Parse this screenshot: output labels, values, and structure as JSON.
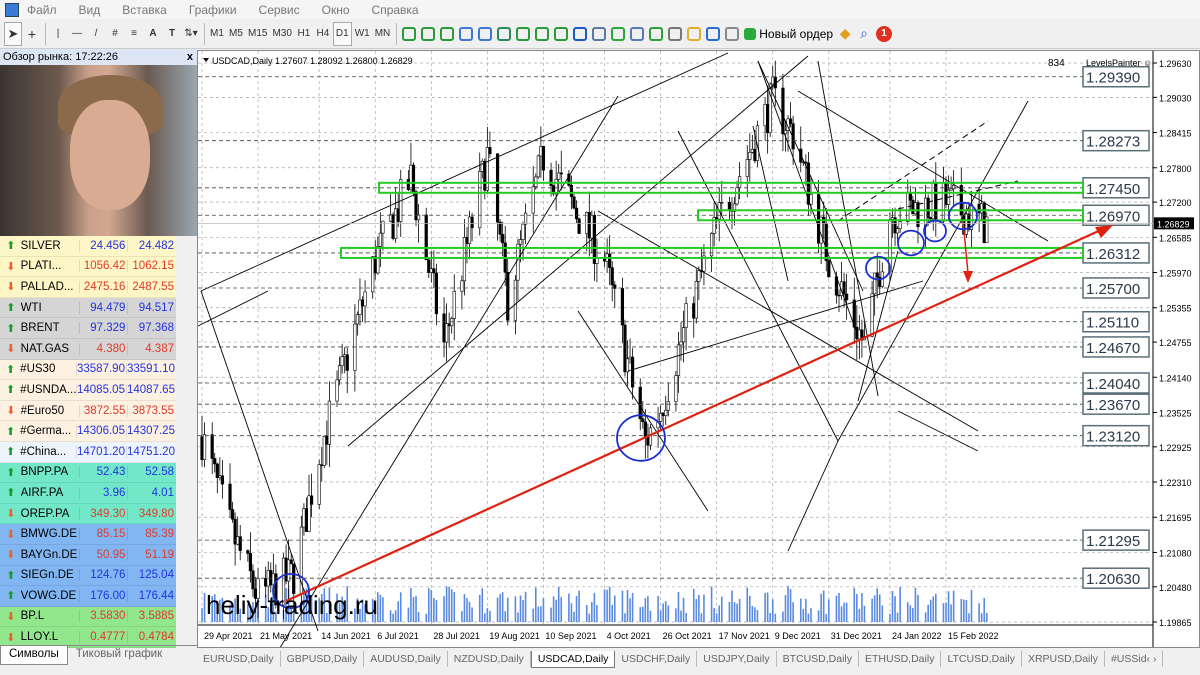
{
  "menu": [
    "Файл",
    "Вид",
    "Вставка",
    "Графики",
    "Сервис",
    "Окно",
    "Справка"
  ],
  "toolbar": {
    "timeframes": [
      "M1",
      "M5",
      "M15",
      "M30",
      "H1",
      "H4",
      "D1",
      "W1",
      "MN"
    ],
    "active_timeframe": "D1",
    "new_order": "Новый ордер",
    "notification_count": "1"
  },
  "market_watch": {
    "title": "Обзор рынка: 17:22:26",
    "close": "x",
    "rows": [
      {
        "sym": "SILVER",
        "bid": "24.456",
        "ask": "24.482",
        "dir": "up",
        "bg": "#fdf6c6"
      },
      {
        "sym": "PLATI...",
        "bid": "1056.42",
        "ask": "1062.15",
        "dir": "dn",
        "bg": "#fdf6c6"
      },
      {
        "sym": "PALLAD...",
        "bid": "2475.16",
        "ask": "2487.55",
        "dir": "dn",
        "bg": "#fdf6c6"
      },
      {
        "sym": "WTI",
        "bid": "94.479",
        "ask": "94.517",
        "dir": "up",
        "bg": "#d5d5d5"
      },
      {
        "sym": "BRENT",
        "bid": "97.329",
        "ask": "97.368",
        "dir": "up",
        "bg": "#d5d5d5"
      },
      {
        "sym": "NAT.GAS",
        "bid": "4.380",
        "ask": "4.387",
        "dir": "dn",
        "bg": "#d5d5d5"
      },
      {
        "sym": "#US30",
        "bid": "33587.90",
        "ask": "33591.10",
        "dir": "up",
        "bg": "#fdf1e2"
      },
      {
        "sym": "#USNDA...",
        "bid": "14085.05",
        "ask": "14087.65",
        "dir": "up",
        "bg": "#fdf1e2"
      },
      {
        "sym": "#Euro50",
        "bid": "3872.55",
        "ask": "3873.55",
        "dir": "dn",
        "bg": "#fdf1e2"
      },
      {
        "sym": "#Germa...",
        "bid": "14306.05",
        "ask": "14307.25",
        "dir": "up",
        "bg": "#fdf1e2"
      },
      {
        "sym": "#China...",
        "bid": "14701.20",
        "ask": "14751.20",
        "dir": "up",
        "bg": "#eef4fc"
      },
      {
        "sym": "BNPP.PA",
        "bid": "52.43",
        "ask": "52.58",
        "dir": "up",
        "bg": "#72e8c8"
      },
      {
        "sym": "AIRF.PA",
        "bid": "3.96",
        "ask": "4.01",
        "dir": "up",
        "bg": "#72e8c8"
      },
      {
        "sym": "OREP.PA",
        "bid": "349.30",
        "ask": "349.80",
        "dir": "dn",
        "bg": "#72e8c8"
      },
      {
        "sym": "BMWG.DE",
        "bid": "85.15",
        "ask": "85.39",
        "dir": "dn",
        "bg": "#82b6f2"
      },
      {
        "sym": "BAYGn.DE",
        "bid": "50.95",
        "ask": "51.19",
        "dir": "dn",
        "bg": "#82b6f2"
      },
      {
        "sym": "SIEGn.DE",
        "bid": "124.76",
        "ask": "125.04",
        "dir": "up",
        "bg": "#82b6f2"
      },
      {
        "sym": "VOWG.DE",
        "bid": "176.00",
        "ask": "176.44",
        "dir": "up",
        "bg": "#82b6f2"
      },
      {
        "sym": "BP.L",
        "bid": "3.5830",
        "ask": "3.5885",
        "dir": "dn",
        "bg": "#92e68c"
      },
      {
        "sym": "LLOY.L",
        "bid": "0.4777",
        "ask": "0.4784",
        "dir": "dn",
        "bg": "#92e68c"
      }
    ],
    "tabs": [
      "Символы",
      "Тиковый график"
    ]
  },
  "chart": {
    "header": "USDCAD,Daily  1.27607 1.28092 1.26800 1.26829",
    "bar_count": "834",
    "indicator": "LevelsPainter ☺",
    "watermark": "heliy-trading.ru",
    "current_price": "1.26829",
    "price_ticks": [
      "1.29630",
      "1.29030",
      "1.28415",
      "1.27800",
      "1.27200",
      "1.26585",
      "1.25970",
      "1.25355",
      "1.24755",
      "1.24140",
      "1.23525",
      "1.22925",
      "1.22310",
      "1.21695",
      "1.21080",
      "1.20480",
      "1.19865"
    ],
    "date_ticks": [
      "29 Apr 2021",
      "21 May 2021",
      "14 Jun 2021",
      "6 Jul 2021",
      "28 Jul 2021",
      "19 Aug 2021",
      "10 Sep 2021",
      "4 Oct 2021",
      "26 Oct 2021",
      "17 Nov 2021",
      "9 Dec 2021",
      "31 Dec 2021",
      "24 Jan 2022",
      "15 Feb 2022"
    ],
    "levels": [
      "1.29390",
      "1.28273",
      "1.27450",
      "1.26970",
      "1.26312",
      "1.25700",
      "1.25110",
      "1.24670",
      "1.24040",
      "1.23670",
      "1.23120",
      "1.21295",
      "1.20630"
    ],
    "zones": [
      "1.27450",
      "1.26970",
      "1.26312"
    ],
    "colors": {
      "zone": "#22cc22",
      "trend": "#e02010",
      "circle": "#1a2fd0"
    },
    "swing_path": [
      [
        "29 Apr 2021",
        1.231
      ],
      [
        "10 May 2021",
        1.215
      ],
      [
        "21 May 2021",
        1.203
      ],
      [
        "4 Jun 2021",
        1.207
      ],
      [
        "14 Jun 2021",
        1.228
      ],
      [
        "6 Jul 2021",
        1.262
      ],
      [
        "20 Jul 2021",
        1.276
      ],
      [
        "2 Aug 2021",
        1.247
      ],
      [
        "19 Aug 2021",
        1.28
      ],
      [
        "27 Aug 2021",
        1.255
      ],
      [
        "10 Sep 2021",
        1.28
      ],
      [
        "4 Oct 2021",
        1.262
      ],
      [
        "20 Oct 2021",
        1.23
      ],
      [
        "26 Oct 2021",
        1.236
      ],
      [
        "17 Nov 2021",
        1.268
      ],
      [
        "9 Dec 2021",
        1.29
      ],
      [
        "17 Dec 2021",
        1.284
      ],
      [
        "31 Dec 2021",
        1.262
      ],
      [
        "14 Jan 2022",
        1.247
      ],
      [
        "24 Jan 2022",
        1.27
      ],
      [
        "15 Feb 2022",
        1.272
      ],
      [
        "3 Mar 2022",
        1.268
      ]
    ]
  },
  "tabs": [
    "EURUSD,Daily",
    "GBPUSD,Daily",
    "AUDUSD,Daily",
    "NZDUSD,Daily",
    "USDCAD,Daily",
    "USDCHF,Daily",
    "USDJPY,Daily",
    "BTCUSD,Daily",
    "ETHUSD,Daily",
    "LTCUSD,Daily",
    "XRPUSD,Daily",
    "#USSid‹ ›"
  ],
  "active_tab": "USDCAD,Daily"
}
